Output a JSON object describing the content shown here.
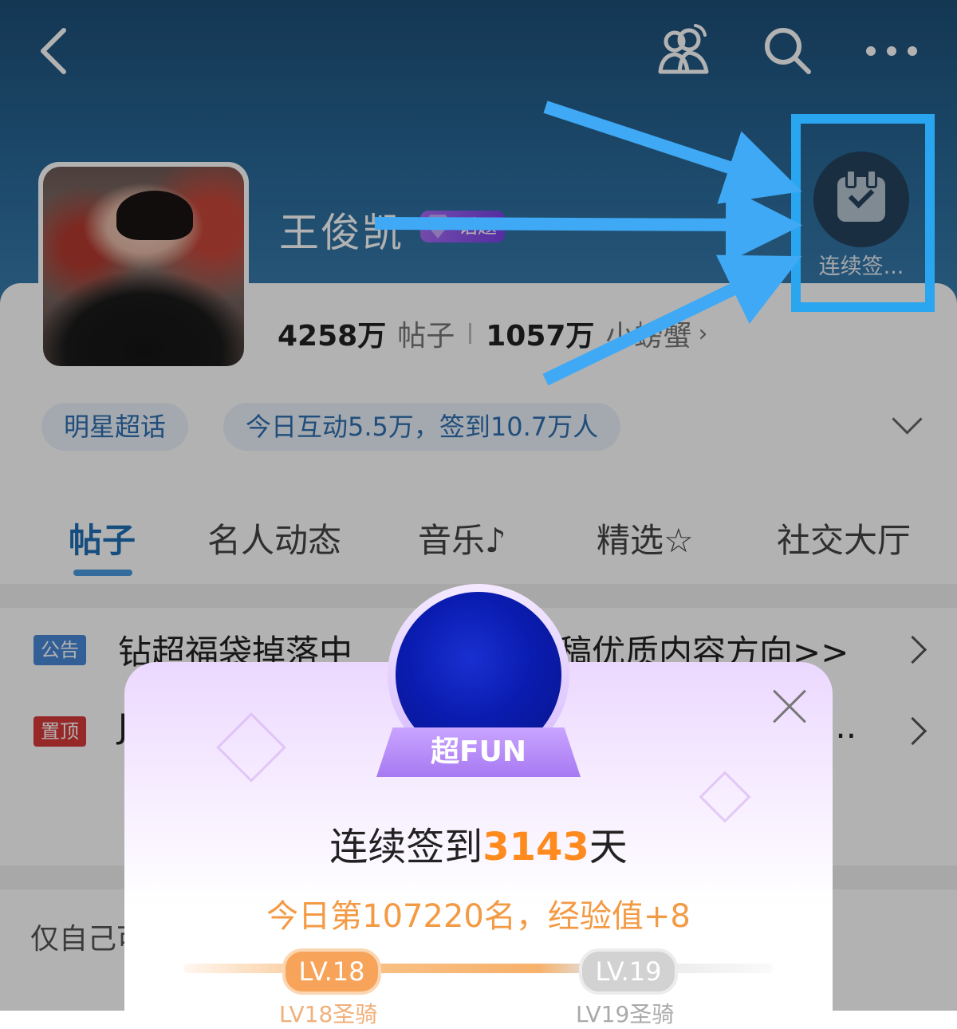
{
  "header": {
    "back_icon": "chevron-left-icon",
    "actions": [
      "people-icon",
      "search-icon",
      "more-icon"
    ],
    "name": "王俊凯",
    "topic_badge": "话题",
    "stats": {
      "posts": "4258万",
      "posts_label": "帖子",
      "members": "1057万",
      "members_label": "小螃蟹"
    },
    "signin_label": "连续签...",
    "tags": [
      "明星超话",
      "今日互动5.5万，签到10.7万人"
    ]
  },
  "tabs": [
    "帖子",
    "名人动态",
    "音乐♪",
    "精选",
    "社交大厅"
  ],
  "notices": [
    {
      "badge": "公告",
      "badge_color": "#4a88d8",
      "text": "钻超福袋掉落中",
      "text_tail": "稿优质内容方向>>"
    },
    {
      "badge": "置顶",
      "badge_color": "#d93a3a",
      "text": "J",
      "text_tail": "..."
    }
  ],
  "private_text": "仅自己可",
  "popup": {
    "badge_label": "超FUN",
    "streak_prefix": "连续签到",
    "streak_days": "3143",
    "streak_suffix": "天",
    "rank_text": "今日第107220名，经验值+8",
    "level_current": "LV.18",
    "level_next": "LV.19",
    "level_current_sub": "LV18圣骑",
    "level_next_sub": "LV19圣骑"
  },
  "colors": {
    "accent": "#1f6fb5",
    "highlight": "#2aa6f0",
    "orange": "#ff8a1e"
  }
}
